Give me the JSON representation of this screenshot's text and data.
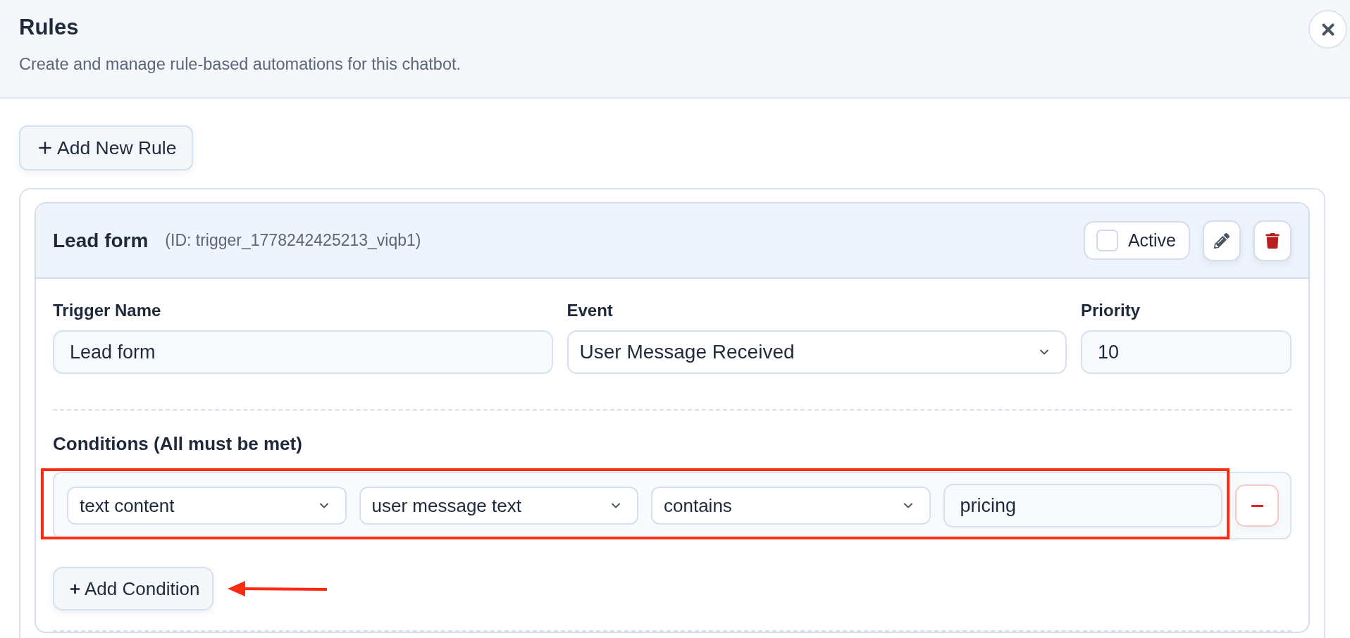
{
  "header": {
    "title": "Rules",
    "subtitle": "Create and manage rule-based automations for this chatbot."
  },
  "add_rule_button": {
    "label": "Add New Rule"
  },
  "rules": [
    {
      "name": "Lead form",
      "id_text": "(ID: trigger_1778242425213_viqb1)",
      "active": false,
      "active_label": "Active",
      "fields": [
        {
          "kind": "text",
          "label": "Trigger Name",
          "value": "Lead form"
        },
        {
          "kind": "select",
          "label": "Event",
          "value": "User Message Received"
        },
        {
          "kind": "text",
          "label": "Priority",
          "value": "10"
        }
      ],
      "conditions_title": "Conditions (All must be met)",
      "conditions": [
        {
          "highlighted": true,
          "parts": [
            {
              "kind": "select",
              "value": "text content"
            },
            {
              "kind": "select",
              "value": "user message text"
            },
            {
              "kind": "select",
              "value": "contains"
            },
            {
              "kind": "text",
              "value": "pricing"
            }
          ]
        }
      ],
      "add_condition": {
        "label": "Add Condition",
        "pointed_at": true
      }
    }
  ]
}
